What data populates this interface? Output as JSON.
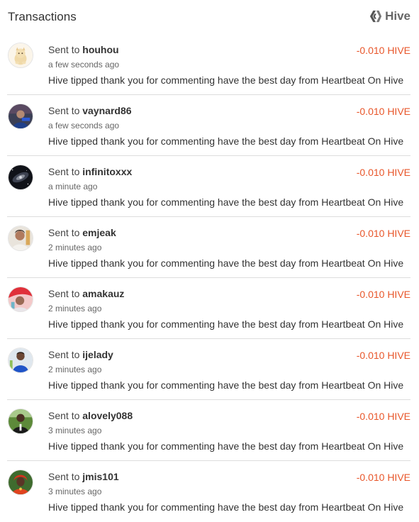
{
  "header": {
    "title": "Transactions",
    "brand_label": "Hive",
    "brand_icon": "hive-logo-icon"
  },
  "colors": {
    "amount": "#e8562a",
    "divider": "#dddddd"
  },
  "transactions": [
    {
      "prefix": "Sent to",
      "user": "houhou",
      "time": "a few seconds ago",
      "amount": "-0.010 HIVE",
      "memo": "Hive tipped thank you for commenting have the best day from Heartbeat On Hive",
      "avatar_icon": "cat-avatar-icon"
    },
    {
      "prefix": "Sent to",
      "user": "vaynard86",
      "time": "a few seconds ago",
      "amount": "-0.010 HIVE",
      "memo": "Hive tipped thank you for commenting have the best day from Heartbeat On Hive",
      "avatar_icon": "user-avatar-icon"
    },
    {
      "prefix": "Sent to",
      "user": "infinitoxxx",
      "time": "a minute ago",
      "amount": "-0.010 HIVE",
      "memo": "Hive tipped thank you for commenting have the best day from Heartbeat On Hive",
      "avatar_icon": "galaxy-avatar-icon"
    },
    {
      "prefix": "Sent to",
      "user": "emjeak",
      "time": "2 minutes ago",
      "amount": "-0.010 HIVE",
      "memo": "Hive tipped thank you for commenting have the best day from Heartbeat On Hive",
      "avatar_icon": "user-avatar-icon"
    },
    {
      "prefix": "Sent to",
      "user": "amakauz",
      "time": "2 minutes ago",
      "amount": "-0.010 HIVE",
      "memo": "Hive tipped thank you for commenting have the best day from Heartbeat On Hive",
      "avatar_icon": "user-avatar-icon"
    },
    {
      "prefix": "Sent to",
      "user": "ijelady",
      "time": "2 minutes ago",
      "amount": "-0.010 HIVE",
      "memo": "Hive tipped thank you for commenting have the best day from Heartbeat On Hive",
      "avatar_icon": "user-avatar-icon"
    },
    {
      "prefix": "Sent to",
      "user": "alovely088",
      "time": "3 minutes ago",
      "amount": "-0.010 HIVE",
      "memo": "Hive tipped thank you for commenting have the best day from Heartbeat On Hive",
      "avatar_icon": "user-avatar-icon"
    },
    {
      "prefix": "Sent to",
      "user": "jmis101",
      "time": "3 minutes ago",
      "amount": "-0.010 HIVE",
      "memo": "Hive tipped thank you for commenting have the best day from Heartbeat On Hive",
      "avatar_icon": "user-avatar-icon"
    }
  ]
}
